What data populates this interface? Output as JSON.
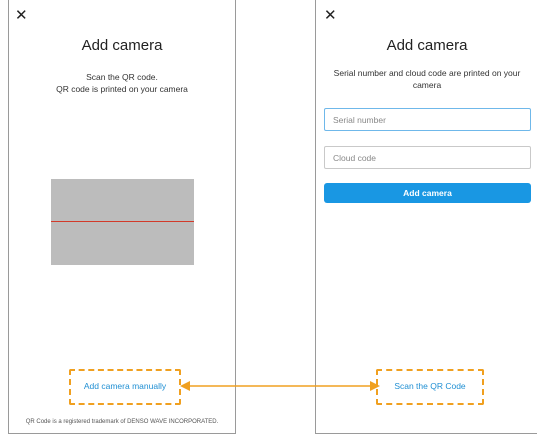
{
  "left": {
    "close_glyph": "✕",
    "title": "Add camera",
    "subtitle_line1": "Scan the QR code.",
    "subtitle_line2": "QR code is printed on your camera",
    "manual_link": "Add camera manually",
    "trademark": "QR Code is a registered trademark of DENSO WAVE INCORPORATED."
  },
  "right": {
    "close_glyph": "✕",
    "title": "Add camera",
    "subtitle": "Serial number and cloud code are printed on your camera",
    "serial_placeholder": "Serial number",
    "cloud_placeholder": "Cloud code",
    "add_button": "Add camera",
    "scan_link": "Scan the QR Code"
  },
  "colors": {
    "accent": "#1997e3",
    "highlight": "#f0a020",
    "scan_line": "#d23a2a"
  }
}
